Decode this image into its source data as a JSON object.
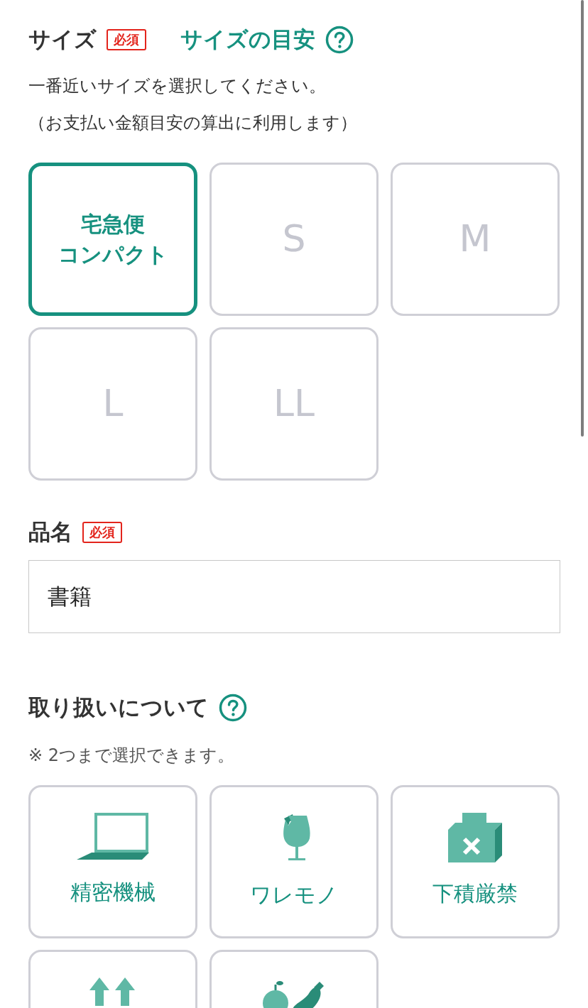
{
  "size_section": {
    "title": "サイズ",
    "badge": "必須",
    "guide_link": "サイズの目安",
    "description": [
      "一番近いサイズを選択してください。",
      "（お支払い金額目安の算出に利用します）"
    ],
    "options": [
      {
        "label_lines": [
          "宅急便",
          "コンパクト"
        ],
        "selected": true
      },
      {
        "label_lines": [
          "S"
        ],
        "selected": false
      },
      {
        "label_lines": [
          "M"
        ],
        "selected": false
      },
      {
        "label_lines": [
          "L"
        ],
        "selected": false
      },
      {
        "label_lines": [
          "LL"
        ],
        "selected": false
      }
    ]
  },
  "product_name": {
    "title": "品名",
    "badge": "必須",
    "value": "書籍"
  },
  "handling": {
    "title": "取り扱いについて",
    "note": "※ 2つまで選択できます。",
    "options": [
      {
        "kind": "laptop",
        "label": "精密機械",
        "selected": false
      },
      {
        "kind": "glass",
        "label": "ワレモノ",
        "selected": false
      },
      {
        "kind": "nostack",
        "label": "下積厳禁",
        "selected": false
      },
      {
        "kind": "arrows",
        "selected": false
      },
      {
        "kind": "produce",
        "selected": false
      }
    ]
  }
}
